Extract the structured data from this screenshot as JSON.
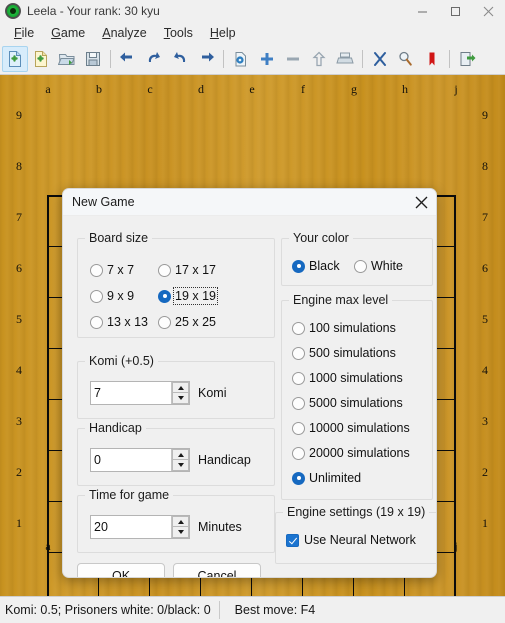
{
  "window": {
    "title": "Leela - Your rank: 30 kyu",
    "icon": "leela-app-icon",
    "controls": [
      {
        "name": "minimize-button",
        "glyph": "minimize-icon"
      },
      {
        "name": "maximize-button",
        "glyph": "maximize-icon"
      },
      {
        "name": "close-button",
        "glyph": "close-icon"
      }
    ]
  },
  "menubar": {
    "items": [
      {
        "label": "File",
        "mnemonic": "F",
        "rest": "ile"
      },
      {
        "label": "Game",
        "mnemonic": "G",
        "rest": "ame"
      },
      {
        "label": "Analyze",
        "mnemonic": "A",
        "rest": "nalyze"
      },
      {
        "label": "Tools",
        "mnemonic": "T",
        "rest": "ools"
      },
      {
        "label": "Help",
        "mnemonic": "H",
        "rest": "elp"
      }
    ]
  },
  "toolbar": {
    "buttons": [
      {
        "name": "new-game-icon",
        "selected": true
      },
      {
        "name": "new-board-icon",
        "selected": false
      },
      {
        "name": "open-file-icon",
        "selected": false
      },
      {
        "name": "save-file-icon",
        "selected": false
      },
      {
        "name": "first-move-icon",
        "selected": false
      },
      {
        "name": "undo-icon",
        "selected": false
      },
      {
        "name": "redo-icon",
        "selected": false
      },
      {
        "name": "last-move-icon",
        "selected": false
      },
      {
        "name": "game-properties-icon",
        "selected": false
      },
      {
        "name": "add-variation-icon",
        "selected": false
      },
      {
        "name": "remove-variation-icon",
        "selected": false
      },
      {
        "name": "promote-variation-icon",
        "selected": false
      },
      {
        "name": "print-icon",
        "selected": false
      },
      {
        "name": "score-estimate-icon",
        "selected": false
      },
      {
        "name": "analyze-icon",
        "selected": false
      },
      {
        "name": "bookmark-icon",
        "selected": false
      },
      {
        "name": "exit-icon",
        "selected": false
      }
    ]
  },
  "board": {
    "size_label": "9 x 9",
    "columns": [
      "a",
      "b",
      "c",
      "d",
      "e",
      "f",
      "g",
      "h",
      "j"
    ],
    "rows": [
      "9",
      "8",
      "7",
      "6",
      "5",
      "4",
      "3",
      "2",
      "1"
    ],
    "wood_color": "#cc9428"
  },
  "dialog": {
    "title": "New Game",
    "close_glyph": "close-icon",
    "board_size": {
      "legend": "Board size",
      "options": [
        {
          "label": "7 x 7",
          "selected": false,
          "focused": false
        },
        {
          "label": "17 x 17",
          "selected": false,
          "focused": false
        },
        {
          "label": "9 x 9",
          "selected": false,
          "focused": false
        },
        {
          "label": "19 x 19",
          "selected": true,
          "focused": true
        },
        {
          "label": "13 x 13",
          "selected": false,
          "focused": false
        },
        {
          "label": "25 x 25",
          "selected": false,
          "focused": false
        }
      ]
    },
    "komi": {
      "legend": "Komi (+0.5)",
      "value": "7",
      "label": "Komi"
    },
    "handicap": {
      "legend": "Handicap",
      "value": "0",
      "label": "Handicap"
    },
    "time_for_game": {
      "legend": "Time for game",
      "value": "20",
      "label": "Minutes"
    },
    "your_color": {
      "legend": "Your color",
      "options": [
        {
          "label": "Black",
          "selected": true
        },
        {
          "label": "White",
          "selected": false
        }
      ]
    },
    "engine_max_level": {
      "legend": "Engine max level",
      "options": [
        {
          "label": "100 simulations",
          "selected": false
        },
        {
          "label": "500 simulations",
          "selected": false
        },
        {
          "label": "1000 simulations",
          "selected": false
        },
        {
          "label": "5000 simulations",
          "selected": false
        },
        {
          "label": "10000 simulations",
          "selected": false
        },
        {
          "label": "20000 simulations",
          "selected": false
        },
        {
          "label": "Unlimited",
          "selected": true
        }
      ]
    },
    "engine_settings": {
      "legend": "Engine settings (19 x 19)",
      "use_neural_network": {
        "label": "Use Neural Network",
        "checked": true
      }
    },
    "ok_label": "OK",
    "cancel_label": "Cancel"
  },
  "statusbar": {
    "left": "Komi: 0.5; Prisoners white: 0/black: 0",
    "right": "Best move: F4"
  },
  "colors": {
    "accent": "#1669c0",
    "board": "#cc9428",
    "chrome": "#f0f0f0"
  }
}
